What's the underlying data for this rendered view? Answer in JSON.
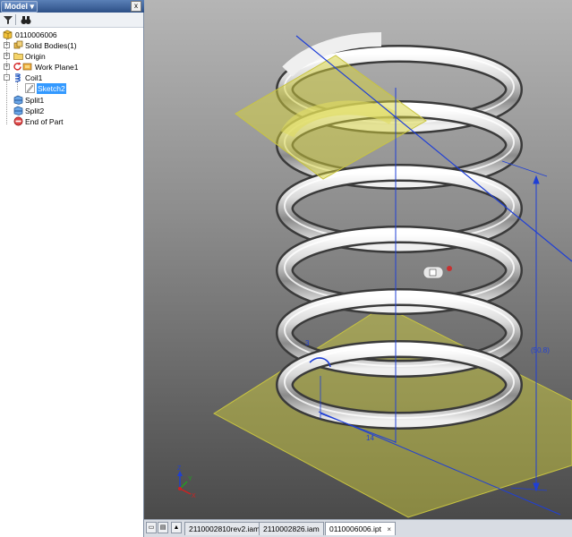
{
  "browser": {
    "title": "Model",
    "close_glyph": "x",
    "toolbar": {
      "filter_icon": "filter-icon",
      "find_icon": "binoculars-icon"
    },
    "tree": [
      {
        "label": "0110006006",
        "icon": "part-icon"
      },
      {
        "label": "Solid Bodies(1)",
        "icon": "solid-bodies-icon",
        "expander": "+"
      },
      {
        "label": "Origin",
        "icon": "folder-icon",
        "expander": "+"
      },
      {
        "label": "Work Plane1",
        "icon": "work-plane-icon",
        "expander": "+"
      },
      {
        "label": "Coil1",
        "icon": "coil-icon",
        "expander": "-"
      },
      {
        "label": "Sketch2",
        "icon": "sketch-icon",
        "selected": true
      },
      {
        "label": "Split1",
        "icon": "split-icon"
      },
      {
        "label": "Split2",
        "icon": "split-icon"
      },
      {
        "label": "End of Part",
        "icon": "end-of-part-icon"
      }
    ]
  },
  "viewport": {
    "dimension_height": "(50.8)",
    "dimension_width": "14",
    "dimension_angle": "3",
    "triad": {
      "z": "Z",
      "y": "Y",
      "x": "X"
    },
    "colors": {
      "plane": "#d8d43a",
      "dimension": "#1f3fd6",
      "coil": "#c8c8c8"
    }
  },
  "tabbar": {
    "tabs": [
      {
        "label": "2110002810rev2.iam",
        "active": false
      },
      {
        "label": "2110002826.iam",
        "active": false
      },
      {
        "label": "0110006006.ipt",
        "active": true
      }
    ],
    "close_glyph": "×"
  }
}
